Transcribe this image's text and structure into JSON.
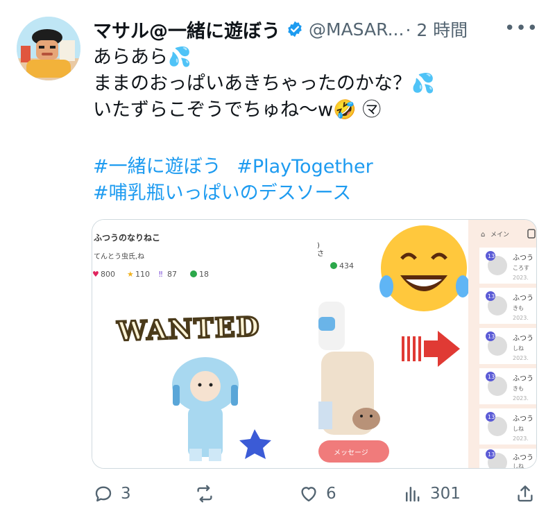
{
  "author": {
    "display_name": "マサル@一緒に遊ぼう",
    "handle": "@MASAR...",
    "time": "· 2 時間",
    "avatar_icon": "avatar-cartoon-icon",
    "verified_icon": "verified-badge-icon"
  },
  "tweet": {
    "lines": [
      "あらあら💦",
      "ままのおっぱいあきちゃったのかな？💦",
      "いたずらこぞうでちゅね〜w🤣 ㋮"
    ],
    "hashtags": [
      "#一緒に遊ぼう",
      "#PlayTogether",
      "#哺乳瓶いっぱいのデスソース"
    ]
  },
  "media": {
    "left": {
      "name": "ふつうのなりねこ",
      "subtitle": "てんとう虫氏,ね",
      "stats": [
        "800",
        "110",
        "87",
        "18"
      ],
      "wanted": "WANTED"
    },
    "middle": {
      "top_text": ")",
      "sub_text": "さ",
      "stat": "434",
      "message_button": "メッセージ"
    },
    "right": {
      "tab": "メイン",
      "rows": [
        {
          "badge": "13",
          "name": "ふつう",
          "sub": "ころす",
          "date": "2023."
        },
        {
          "badge": "13",
          "name": "ふつう",
          "sub": "きも",
          "date": "2023."
        },
        {
          "badge": "13",
          "name": "ふつう",
          "sub": "しね",
          "date": "2023."
        },
        {
          "badge": "13",
          "name": "ふつう",
          "sub": "きも",
          "date": "2023."
        },
        {
          "badge": "13",
          "name": "ふつう",
          "sub": "しね",
          "date": "2023."
        },
        {
          "badge": "13",
          "name": "ふつう",
          "sub": "しね",
          "date": ""
        }
      ]
    }
  },
  "actions": {
    "reply_count": "3",
    "retweet_count": "",
    "like_count": "6",
    "view_count": "301",
    "colors": {
      "muted": "#536471",
      "link": "#1d9bf0"
    }
  }
}
